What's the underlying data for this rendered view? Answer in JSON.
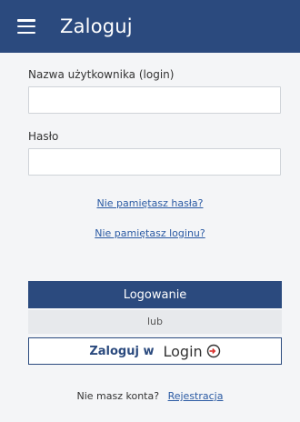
{
  "header": {
    "title": "Zaloguj",
    "background_color": "#2b4a7e"
  },
  "form": {
    "username_label": "Nazwa użytkownika (login)",
    "username_value": "",
    "password_label": "Hasło",
    "password_value": "",
    "forgot_password_link": "Nie pamiętasz hasła?",
    "forgot_login_link": "Nie pamiętasz loginu?",
    "submit_label": "Logowanie",
    "or_text": "lub",
    "alt_login_label": "Zaloguj w",
    "alt_login_logo_text": "Login",
    "alt_login_icon": "login-door-icon",
    "accent_color": "#2b4a7e",
    "link_color": "#2b5aa3",
    "icon_accent_color": "#d9302c"
  },
  "footer": {
    "no_account_text": "Nie masz konta?",
    "register_link": "Rejestracja"
  }
}
